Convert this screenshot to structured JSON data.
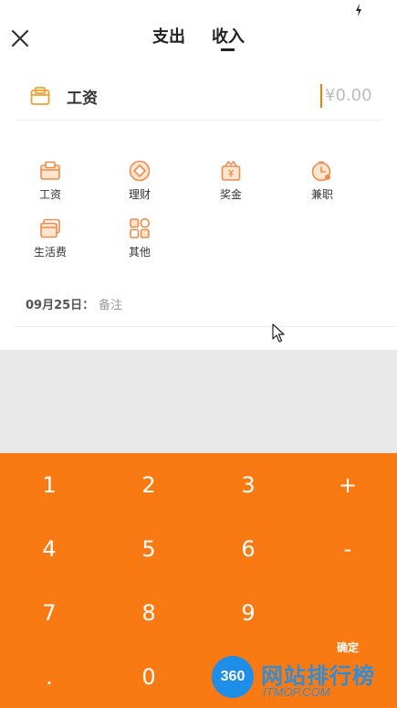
{
  "header": {
    "tabs": [
      {
        "label": "支出"
      },
      {
        "label": "收入"
      }
    ]
  },
  "entry": {
    "category": "工资",
    "amount": "¥0.00"
  },
  "categories": [
    {
      "label": "工资",
      "icon": "wage-icon"
    },
    {
      "label": "理财",
      "icon": "finance-icon"
    },
    {
      "label": "奖金",
      "icon": "bonus-icon"
    },
    {
      "label": "兼职",
      "icon": "parttime-icon"
    },
    {
      "label": "生活费",
      "icon": "living-expense-icon"
    },
    {
      "label": "其他",
      "icon": "other-icon"
    }
  ],
  "note": {
    "date": "09月25日：",
    "text": "备注"
  },
  "keypad": {
    "keys": [
      "1",
      "2",
      "3",
      "+",
      "4",
      "5",
      "6",
      "-",
      "7",
      "8",
      "9",
      ".",
      "0",
      "确定"
    ]
  },
  "watermark": {
    "badge": "360",
    "title": "网站排行榜",
    "subtitle": "ITMOP.COM"
  },
  "colors": {
    "accent": "#f97a12",
    "icon": "#f08a4b",
    "gray": "#e9e9e9"
  }
}
